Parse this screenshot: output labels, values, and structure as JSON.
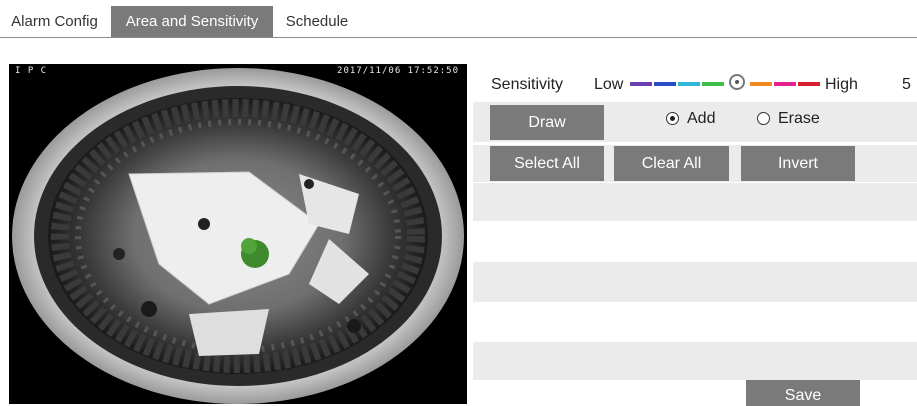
{
  "tabs": [
    {
      "label": "Alarm Config",
      "active": false
    },
    {
      "label": "Area and Sensitivity",
      "active": true
    },
    {
      "label": "Schedule",
      "active": false
    }
  ],
  "video": {
    "channel_label": "I P C",
    "timestamp": "2017/11/06 17:52:50"
  },
  "sensitivity": {
    "label": "Sensitivity",
    "low_label": "Low",
    "high_label": "High",
    "value": "5",
    "slider_colors": [
      "#6a3fb0",
      "#2a4cc8",
      "#2fb8d8",
      "#3cc04a",
      "#f08a1c",
      "#e8208c",
      "#d61e2e"
    ]
  },
  "draw_row": {
    "draw_label": "Draw",
    "add_label": "Add",
    "erase_label": "Erase",
    "selected_mode": "Add"
  },
  "select_row": {
    "select_all_label": "Select All",
    "clear_all_label": "Clear All",
    "invert_label": "Invert"
  },
  "save_label": "Save",
  "colors": {
    "tab_active_bg": "#7a7a7a",
    "button_bg": "#7a7a7a",
    "row_bg": "#ebebeb"
  }
}
